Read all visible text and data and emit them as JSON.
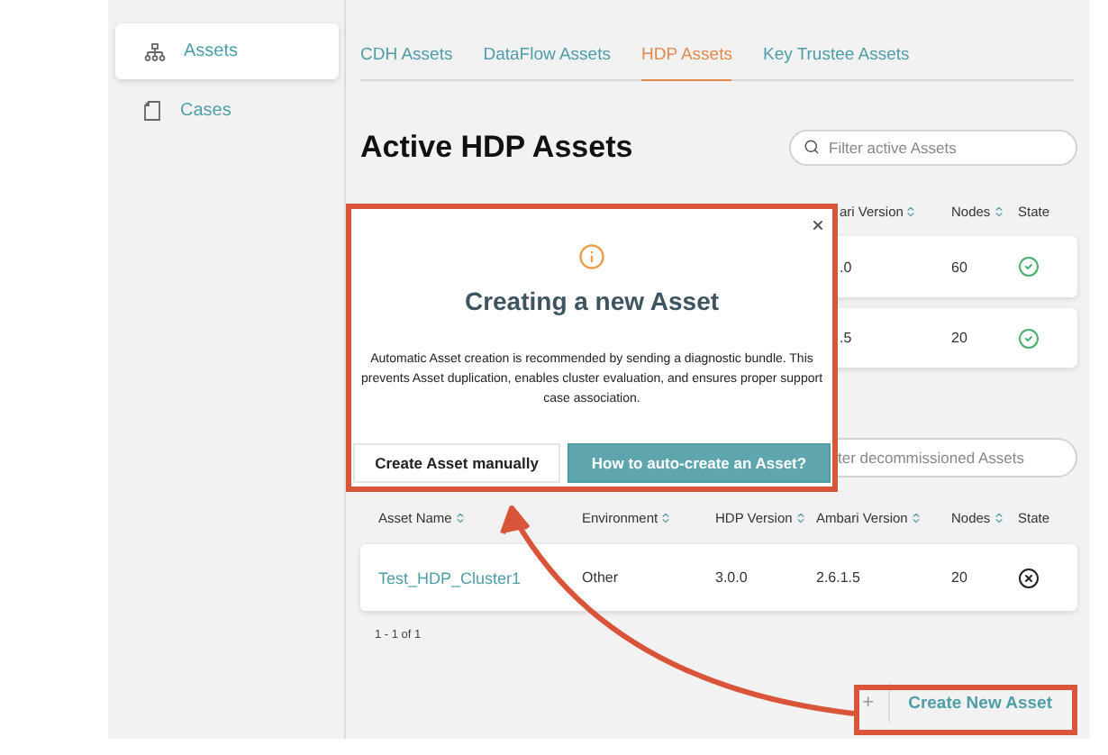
{
  "sidebar": {
    "items": [
      {
        "label": "Assets",
        "selected": true
      },
      {
        "label": "Cases",
        "selected": false
      }
    ]
  },
  "tabs": [
    {
      "label": "CDH Assets",
      "selected": false
    },
    {
      "label": "DataFlow Assets",
      "selected": false
    },
    {
      "label": "HDP Assets",
      "selected": true
    },
    {
      "label": "Key Trustee Assets",
      "selected": false
    }
  ],
  "active_assets": {
    "title": "Active HDP Assets",
    "filter": {
      "placeholder": "Filter active Assets"
    },
    "columns": [
      {
        "label": "ari Version",
        "sortable": true
      },
      {
        "label": "Nodes",
        "sortable": true
      },
      {
        "label": "State",
        "sortable": false
      }
    ],
    "rows": [
      {
        "ambari_version": ".0",
        "nodes": "60",
        "kind": "check"
      },
      {
        "ambari_version": ".5",
        "nodes": "20",
        "kind": "check"
      }
    ]
  },
  "decommissioned_assets": {
    "filter": {
      "placeholder": "ter decommissioned Assets"
    },
    "columns": [
      {
        "label": "Asset Name",
        "sortable": true
      },
      {
        "label": "Environment",
        "sortable": true
      },
      {
        "label": "HDP Version",
        "sortable": true
      },
      {
        "label": "Ambari Version",
        "sortable": true
      },
      {
        "label": "Nodes",
        "sortable": true
      },
      {
        "label": "State",
        "sortable": false
      }
    ],
    "rows": [
      {
        "asset_name": "Test_HDP_Cluster1",
        "environment": "Other",
        "hdp_version": "3.0.0",
        "ambari_version": "2.6.1.5",
        "nodes": "20",
        "kind": "cross"
      }
    ],
    "pagination": "1 - 1 of 1"
  },
  "create_button": {
    "icon": "+",
    "label": "Create New Asset"
  },
  "dialog": {
    "title": "Creating a new Asset",
    "message": "Automatic Asset creation is recommended by sending a diagnostic bundle. This prevents Asset duplication, enables cluster evaluation, and ensures proper support case association.",
    "buttons": [
      {
        "label": "Create Asset manually",
        "kind": "secondary"
      },
      {
        "label": "How to auto-create an Asset?",
        "kind": "primary"
      }
    ]
  }
}
